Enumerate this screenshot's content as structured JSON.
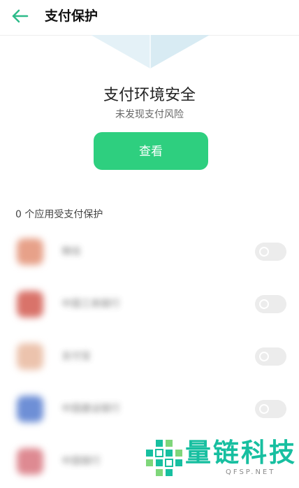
{
  "header": {
    "title": "支付保护",
    "back_icon": "arrow-left-icon"
  },
  "status": {
    "title": "支付环境安全",
    "subtitle": "未发现支付风险"
  },
  "view_button": {
    "label": "查看"
  },
  "app_count": "0 个应用受支付保护",
  "apps": [
    {
      "name": "微信",
      "icon_color": "#e7a189",
      "enabled": false
    },
    {
      "name": "中国工商银行",
      "icon_color": "#d9736a",
      "enabled": false
    },
    {
      "name": "支付宝",
      "icon_color": "#ecc3ad",
      "enabled": false
    },
    {
      "name": "中国建设银行",
      "icon_color": "#6e8fd6",
      "enabled": false
    },
    {
      "name": "中国银行",
      "icon_color": "#de8a92",
      "enabled": false
    }
  ],
  "watermark": {
    "text": "量链科技",
    "sub": "QFSP.NET"
  },
  "colors": {
    "accent": "#2ecf7f",
    "back_arrow": "#2dbb8a",
    "watermark": "#17bfa0"
  }
}
